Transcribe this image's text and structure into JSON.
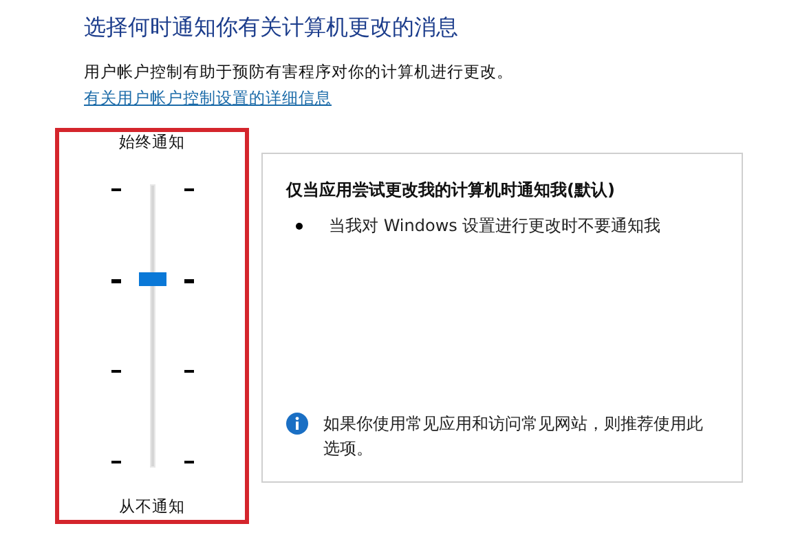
{
  "title": "选择何时通知你有关计算机更改的消息",
  "description": "用户帐户控制有助于预防有害程序对你的计算机进行更改。",
  "link": "有关用户帐户控制设置的详细信息",
  "slider": {
    "top_label": "始终通知",
    "bottom_label": "从不通知",
    "level": 0.6667
  },
  "panel": {
    "heading": "仅当应用尝试更改我的计算机时通知我(默认)",
    "bullets": [
      "当我对 Windows 设置进行更改时不要通知我"
    ],
    "info": "如果你使用常见应用和访问常见网站，则推荐使用此选项。"
  }
}
